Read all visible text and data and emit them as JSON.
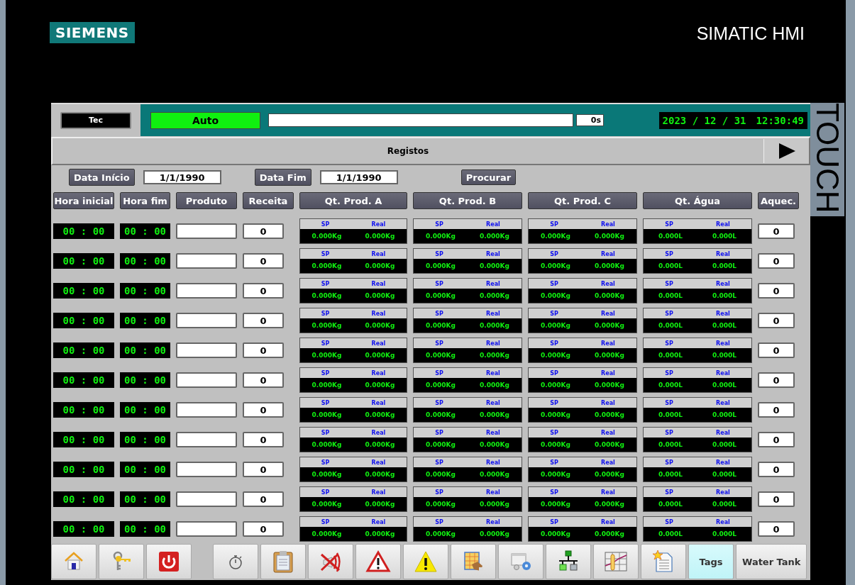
{
  "brand": {
    "logo": "SIEMENS",
    "product": "SIMATIC HMI",
    "side_label": "TOUCH"
  },
  "status": {
    "user": "Tec",
    "mode": "Auto",
    "progress": {
      "level": 0,
      "reading": "0s"
    },
    "date": "2023 / 12 / 31",
    "time": "12:30:49"
  },
  "screen_title": "Registos",
  "filters": {
    "start_label": "Data Início",
    "start_value": "1/1/1990",
    "end_label": "Data Fim",
    "end_value": "1/1/1990",
    "search_button": "Procurar"
  },
  "columns": [
    "Hora inicial",
    "Hora fim",
    "Produto",
    "Receita",
    "Qt. Prod. A",
    "Qt. Prod. B",
    "Qt. Prod. C",
    "Qt. Água",
    "Aquec."
  ],
  "rows": [
    {
      "start": "00 : 00",
      "end": "00 : 00",
      "recipe": "0",
      "quantities": [
        {
          "sp_label": "SP",
          "real_label": "Real",
          "sp": "0.000Kg",
          "real": "0.000Kg"
        },
        {
          "sp_label": "SP",
          "real_label": "Real",
          "sp": "0.000Kg",
          "real": "0.000Kg"
        },
        {
          "sp_label": "SP",
          "real_label": "Real",
          "sp": "0.000Kg",
          "real": "0.000Kg"
        },
        {
          "sp_label": "SP",
          "real_label": "Real",
          "sp": "0.000L",
          "real": "0.000L"
        }
      ],
      "heating": "0"
    },
    {
      "start": "00 : 00",
      "end": "00 : 00",
      "recipe": "0",
      "quantities": [
        {
          "sp_label": "SP",
          "real_label": "Real",
          "sp": "0.000Kg",
          "real": "0.000Kg"
        },
        {
          "sp_label": "SP",
          "real_label": "Real",
          "sp": "0.000Kg",
          "real": "0.000Kg"
        },
        {
          "sp_label": "SP",
          "real_label": "Real",
          "sp": "0.000Kg",
          "real": "0.000Kg"
        },
        {
          "sp_label": "SP",
          "real_label": "Real",
          "sp": "0.000L",
          "real": "0.000L"
        }
      ],
      "heating": "0"
    },
    {
      "start": "00 : 00",
      "end": "00 : 00",
      "recipe": "0",
      "quantities": [
        {
          "sp_label": "SP",
          "real_label": "Real",
          "sp": "0.000Kg",
          "real": "0.000Kg"
        },
        {
          "sp_label": "SP",
          "real_label": "Real",
          "sp": "0.000Kg",
          "real": "0.000Kg"
        },
        {
          "sp_label": "SP",
          "real_label": "Real",
          "sp": "0.000Kg",
          "real": "0.000Kg"
        },
        {
          "sp_label": "SP",
          "real_label": "Real",
          "sp": "0.000L",
          "real": "0.000L"
        }
      ],
      "heating": "0"
    },
    {
      "start": "00 : 00",
      "end": "00 : 00",
      "recipe": "0",
      "quantities": [
        {
          "sp_label": "SP",
          "real_label": "Real",
          "sp": "0.000Kg",
          "real": "0.000Kg"
        },
        {
          "sp_label": "SP",
          "real_label": "Real",
          "sp": "0.000Kg",
          "real": "0.000Kg"
        },
        {
          "sp_label": "SP",
          "real_label": "Real",
          "sp": "0.000Kg",
          "real": "0.000Kg"
        },
        {
          "sp_label": "SP",
          "real_label": "Real",
          "sp": "0.000L",
          "real": "0.000L"
        }
      ],
      "heating": "0"
    },
    {
      "start": "00 : 00",
      "end": "00 : 00",
      "recipe": "0",
      "quantities": [
        {
          "sp_label": "SP",
          "real_label": "Real",
          "sp": "0.000Kg",
          "real": "0.000Kg"
        },
        {
          "sp_label": "SP",
          "real_label": "Real",
          "sp": "0.000Kg",
          "real": "0.000Kg"
        },
        {
          "sp_label": "SP",
          "real_label": "Real",
          "sp": "0.000Kg",
          "real": "0.000Kg"
        },
        {
          "sp_label": "SP",
          "real_label": "Real",
          "sp": "0.000L",
          "real": "0.000L"
        }
      ],
      "heating": "0"
    },
    {
      "start": "00 : 00",
      "end": "00 : 00",
      "recipe": "0",
      "quantities": [
        {
          "sp_label": "SP",
          "real_label": "Real",
          "sp": "0.000Kg",
          "real": "0.000Kg"
        },
        {
          "sp_label": "SP",
          "real_label": "Real",
          "sp": "0.000Kg",
          "real": "0.000Kg"
        },
        {
          "sp_label": "SP",
          "real_label": "Real",
          "sp": "0.000Kg",
          "real": "0.000Kg"
        },
        {
          "sp_label": "SP",
          "real_label": "Real",
          "sp": "0.000L",
          "real": "0.000L"
        }
      ],
      "heating": "0"
    },
    {
      "start": "00 : 00",
      "end": "00 : 00",
      "recipe": "0",
      "quantities": [
        {
          "sp_label": "SP",
          "real_label": "Real",
          "sp": "0.000Kg",
          "real": "0.000Kg"
        },
        {
          "sp_label": "SP",
          "real_label": "Real",
          "sp": "0.000Kg",
          "real": "0.000Kg"
        },
        {
          "sp_label": "SP",
          "real_label": "Real",
          "sp": "0.000Kg",
          "real": "0.000Kg"
        },
        {
          "sp_label": "SP",
          "real_label": "Real",
          "sp": "0.000L",
          "real": "0.000L"
        }
      ],
      "heating": "0"
    },
    {
      "start": "00 : 00",
      "end": "00 : 00",
      "recipe": "0",
      "quantities": [
        {
          "sp_label": "SP",
          "real_label": "Real",
          "sp": "0.000Kg",
          "real": "0.000Kg"
        },
        {
          "sp_label": "SP",
          "real_label": "Real",
          "sp": "0.000Kg",
          "real": "0.000Kg"
        },
        {
          "sp_label": "SP",
          "real_label": "Real",
          "sp": "0.000Kg",
          "real": "0.000Kg"
        },
        {
          "sp_label": "SP",
          "real_label": "Real",
          "sp": "0.000L",
          "real": "0.000L"
        }
      ],
      "heating": "0"
    },
    {
      "start": "00 : 00",
      "end": "00 : 00",
      "recipe": "0",
      "quantities": [
        {
          "sp_label": "SP",
          "real_label": "Real",
          "sp": "0.000Kg",
          "real": "0.000Kg"
        },
        {
          "sp_label": "SP",
          "real_label": "Real",
          "sp": "0.000Kg",
          "real": "0.000Kg"
        },
        {
          "sp_label": "SP",
          "real_label": "Real",
          "sp": "0.000Kg",
          "real": "0.000Kg"
        },
        {
          "sp_label": "SP",
          "real_label": "Real",
          "sp": "0.000L",
          "real": "0.000L"
        }
      ],
      "heating": "0"
    },
    {
      "start": "00 : 00",
      "end": "00 : 00",
      "recipe": "0",
      "quantities": [
        {
          "sp_label": "SP",
          "real_label": "Real",
          "sp": "0.000Kg",
          "real": "0.000Kg"
        },
        {
          "sp_label": "SP",
          "real_label": "Real",
          "sp": "0.000Kg",
          "real": "0.000Kg"
        },
        {
          "sp_label": "SP",
          "real_label": "Real",
          "sp": "0.000Kg",
          "real": "0.000Kg"
        },
        {
          "sp_label": "SP",
          "real_label": "Real",
          "sp": "0.000L",
          "real": "0.000L"
        }
      ],
      "heating": "0"
    },
    {
      "start": "00 : 00",
      "end": "00 : 00",
      "recipe": "0",
      "quantities": [
        {
          "sp_label": "SP",
          "real_label": "Real",
          "sp": "0.000Kg",
          "real": "0.000Kg"
        },
        {
          "sp_label": "SP",
          "real_label": "Real",
          "sp": "0.000Kg",
          "real": "0.000Kg"
        },
        {
          "sp_label": "SP",
          "real_label": "Real",
          "sp": "0.000Kg",
          "real": "0.000Kg"
        },
        {
          "sp_label": "SP",
          "real_label": "Real",
          "sp": "0.000L",
          "real": "0.000L"
        }
      ],
      "heating": "0"
    }
  ],
  "toolbar": [
    {
      "kind": "icon"
    },
    {
      "kind": "icon"
    },
    {
      "kind": "icon"
    },
    {
      "kind": "icon"
    },
    {
      "kind": "icon"
    },
    {
      "kind": "icon"
    },
    {
      "kind": "icon"
    },
    {
      "kind": "icon"
    },
    {
      "kind": "icon"
    },
    {
      "kind": "icon"
    },
    {
      "kind": "icon"
    },
    {
      "kind": "icon"
    },
    {
      "kind": "icon"
    },
    {
      "kind": "text",
      "label": "Tags",
      "selected": true
    },
    {
      "kind": "text",
      "label": "Water Tank",
      "selected": false
    }
  ]
}
